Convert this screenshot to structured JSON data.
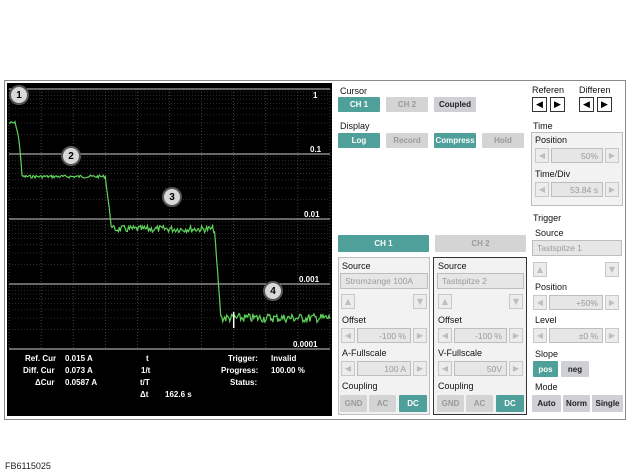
{
  "figure_id": "FB6115025",
  "scope": {
    "y_labels": [
      "1",
      "0.1",
      "0.01",
      "0.001",
      "0.0001"
    ],
    "markers": [
      "1",
      "2",
      "3",
      "4"
    ],
    "readout": {
      "ref_cur_label": "Ref. Cur",
      "ref_cur_value": "0.015 A",
      "diff_cur_label": "Diff. Cur",
      "diff_cur_value": "0.073 A",
      "delta_cur_label": "ΔCur",
      "delta_cur_value": "0.0587 A",
      "t_label": "t",
      "inv_t_label": "1/t",
      "t_T_label": "t/T",
      "delta_t_label": "Δt",
      "delta_t_value": "162.6 s",
      "trigger_label": "Trigger:",
      "trigger_value": "Invalid",
      "progress_label": "Progress:",
      "progress_value": "100.00 %",
      "status_label": "Status:"
    }
  },
  "cursor": {
    "title": "Cursor",
    "ch1": "CH 1",
    "ch2": "CH 2",
    "coupled": "Coupled"
  },
  "display": {
    "title": "Display",
    "log": "Log",
    "record": "Record",
    "compress": "Compress",
    "hold": "Hold"
  },
  "channels": {
    "tab1": "CH 1",
    "tab2": "CH 2",
    "ch1": {
      "source_label": "Source",
      "source_value": "Stromzange 100A",
      "offset_label": "Offset",
      "offset_value": "-100 %",
      "fullscale_label": "A-Fullscale",
      "fullscale_value": "100 A",
      "coupling_label": "Coupling",
      "gnd": "GND",
      "ac": "AC",
      "dc": "DC"
    },
    "ch2": {
      "source_label": "Source",
      "source_value": "Tastspitze 2",
      "offset_label": "Offset",
      "offset_value": "-100 %",
      "fullscale_label": "V-Fullscale",
      "fullscale_value": "50V",
      "coupling_label": "Coupling",
      "gnd": "GND",
      "ac": "AC",
      "dc": "DC"
    }
  },
  "right": {
    "referen": "Referen",
    "differen": "Differen",
    "time_title": "Time",
    "position_label": "Position",
    "position_value": "50%",
    "timediv_label": "Time/Div",
    "timediv_value": "53.84 s",
    "trigger_title": "Trigger",
    "source_label": "Source",
    "source_value": "Tastspitze 1",
    "tpos_label": "Position",
    "tpos_value": "+50%",
    "level_label": "Level",
    "level_value": "±0 %",
    "slope_label": "Slope",
    "pos": "pos",
    "neg": "neg",
    "mode_label": "Mode",
    "auto": "Auto",
    "norm": "Norm",
    "single": "Single"
  },
  "colors": {
    "accent": "#4f9f9a",
    "trace": "#5fd35a",
    "screen": "#000000"
  },
  "trace_levels": [
    {
      "label": "1",
      "from": 0.0,
      "to": 0.02,
      "value": 0.3
    },
    {
      "label": "2",
      "from": 0.04,
      "to": 0.3,
      "value": 0.045
    },
    {
      "label": "3",
      "from": 0.32,
      "to": 0.64,
      "value": 0.007
    },
    {
      "label": "4",
      "from": 0.66,
      "to": 1.0,
      "value": 0.0003
    }
  ]
}
